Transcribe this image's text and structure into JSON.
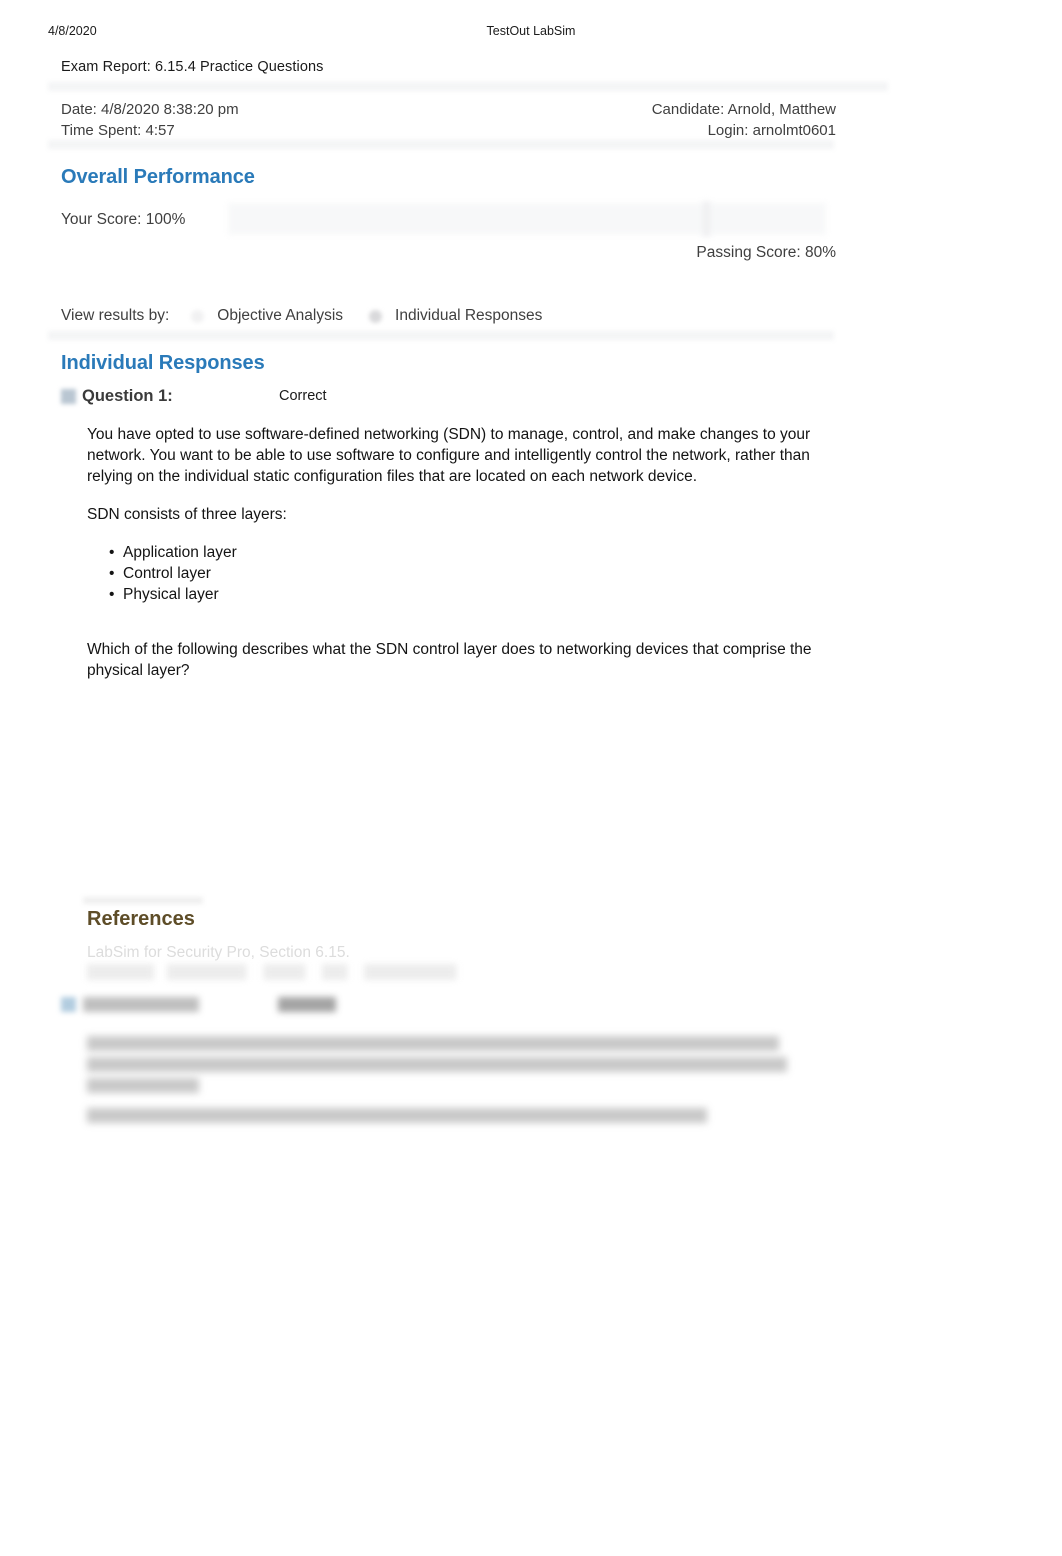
{
  "print_header": {
    "date": "4/8/2020",
    "app_title": "TestOut LabSim"
  },
  "report": {
    "title": "Exam Report: 6.15.4 Practice Questions",
    "meta": {
      "date_label": "Date: 4/8/2020 8:38:20 pm",
      "time_spent_label": "Time Spent: 4:57",
      "candidate_label": "Candidate: Arnold, Matthew",
      "login_label": "Login: arnolmt0601"
    }
  },
  "overall_performance": {
    "heading": "Overall Performance",
    "your_score_label": "Your Score: 100%",
    "your_score_value": 100,
    "passing_score_label": "Passing Score: 80%",
    "passing_score_value": 80
  },
  "view_results_by": {
    "label": "View results by:",
    "options": [
      {
        "label": "Objective Analysis",
        "selected": false
      },
      {
        "label": "Individual Responses",
        "selected": true
      }
    ]
  },
  "individual_responses": {
    "heading": "Individual Responses",
    "questions": [
      {
        "number_label": "Question 1:",
        "status": "Correct",
        "status_icon": "correct-check-icon",
        "paragraph_1": "You have opted to use software-defined networking (SDN) to manage, control, and make changes to your network. You want to be able to use software to configure and intelligently control the network, rather than relying on the individual static configuration files that are located on each network device.",
        "paragraph_2": "SDN consists of three layers:",
        "layers": [
          "Application layer",
          "Control layer",
          "Physical layer"
        ],
        "paragraph_3": "Which of the following describes what the SDN control layer does to networking devices that comprise the physical layer?"
      }
    ]
  },
  "references": {
    "heading": "References",
    "items": [
      "LabSim for Security Pro, Section 6.15."
    ]
  },
  "colors": {
    "section_heading_blue": "#2a7ab9",
    "references_heading_brown": "#5e4d28",
    "body_text": "#141414",
    "meta_text": "#3f3f3f",
    "page_background": "#ffffff"
  }
}
